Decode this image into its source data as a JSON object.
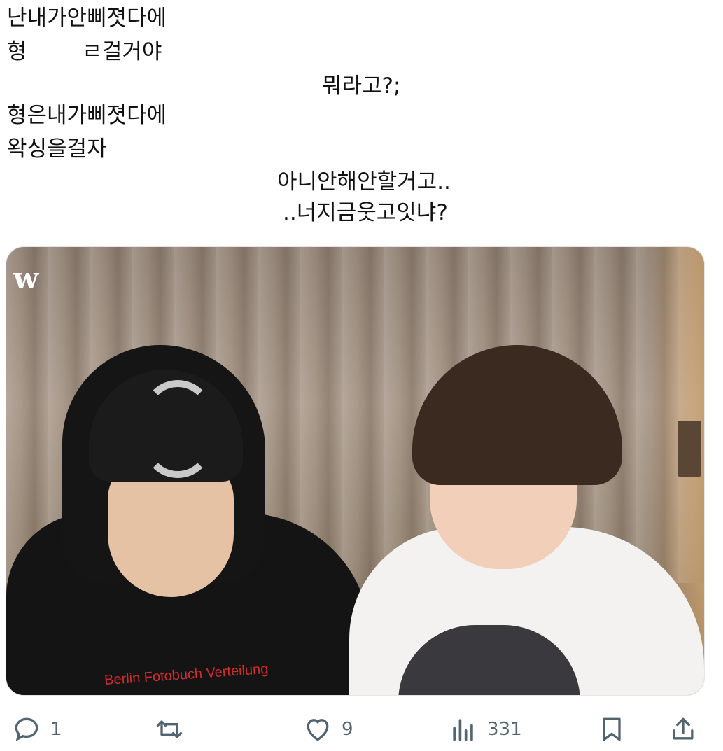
{
  "tweet": {
    "lines": [
      "난내가안삐졋다에",
      "형        ㄹ걸거야",
      "뭐라고?;",
      "형은내가삐졋다에",
      "왁싱을걸자",
      "아니안해안할거고..",
      "..너지금웃고잇냐?"
    ]
  },
  "media": {
    "watermark": "w",
    "shirt_print": "Berlin Fotobuch Verteilung"
  },
  "actions": {
    "reply": {
      "icon": "reply-icon",
      "count": "1"
    },
    "retweet": {
      "icon": "retweet-icon",
      "count": ""
    },
    "like": {
      "icon": "heart-icon",
      "count": "9"
    },
    "views": {
      "icon": "views-icon",
      "count": "331"
    },
    "bookmark": {
      "icon": "bookmark-icon"
    },
    "share": {
      "icon": "share-icon"
    }
  },
  "colors": {
    "icon": "#536471",
    "text": "#0f1419"
  }
}
